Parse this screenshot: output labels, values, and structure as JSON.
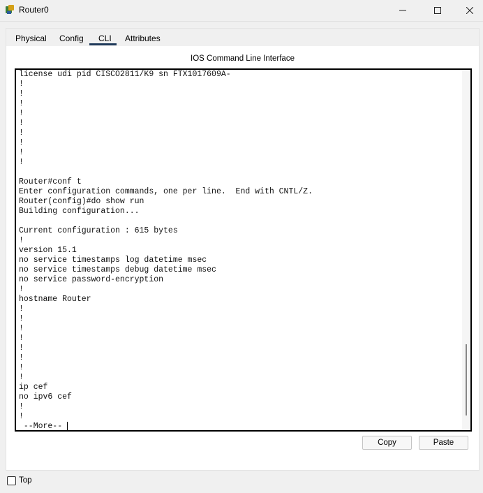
{
  "window": {
    "title": "Router0",
    "minimize_glyph": "—",
    "maximize_glyph": "☐",
    "close_glyph": "✕"
  },
  "tabs": [
    {
      "label": "Physical",
      "active": false
    },
    {
      "label": "Config",
      "active": false
    },
    {
      "label": "CLI",
      "active": true
    },
    {
      "label": "Attributes",
      "active": false
    }
  ],
  "cli": {
    "heading": "IOS Command Line Interface",
    "lines": [
      "license udi pid CISCO2811/K9 sn FTX1017609A-",
      "!",
      "!",
      "!",
      "!",
      "!",
      "!",
      "!",
      "!",
      "!",
      "",
      "Router#conf t",
      "Enter configuration commands, one per line.  End with CNTL/Z.",
      "Router(config)#do show run",
      "Building configuration...",
      "",
      "Current configuration : 615 bytes",
      "!",
      "version 15.1",
      "no service timestamps log datetime msec",
      "no service timestamps debug datetime msec",
      "no service password-encryption",
      "!",
      "hostname Router",
      "!",
      "!",
      "!",
      "!",
      "!",
      "!",
      "!",
      "!",
      "ip cef",
      "no ipv6 cef",
      "!",
      "!"
    ],
    "prompt": " --More--"
  },
  "buttons": {
    "copy": "Copy",
    "paste": "Paste"
  },
  "footer": {
    "top_label": "Top",
    "top_checked": false
  }
}
